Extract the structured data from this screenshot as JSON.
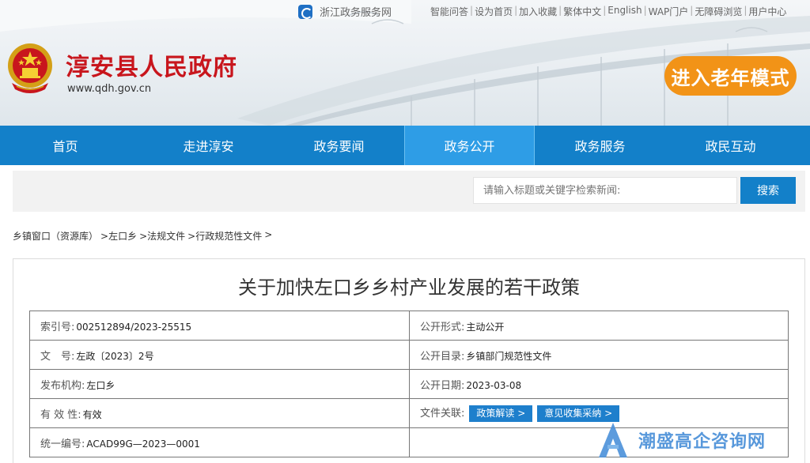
{
  "topbar": {
    "portal_label": "浙江政务服务网",
    "links": [
      "智能问答",
      "设为首页",
      "加入收藏",
      "繁体中文",
      "English",
      "WAP门户",
      "无障碍浏览",
      "用户中心"
    ]
  },
  "header": {
    "site_title": "淳安县人民政府",
    "site_url": "www.qdh.gov.cn",
    "elder_mode_label": "进入老年模式",
    "colors": {
      "title_red": "#c8161d",
      "elder_orange": "#f29317"
    }
  },
  "nav": {
    "items": [
      "首页",
      "走进淳安",
      "政务要闻",
      "政务公开",
      "政务服务",
      "政民互动"
    ],
    "active_index": 3,
    "colors": {
      "bar": "#1380c9",
      "active": "#2e9de6"
    }
  },
  "search": {
    "placeholder": "请输入标题或关键字检索新闻:",
    "button_label": "搜索"
  },
  "breadcrumb": [
    "乡镇窗口（资源库）",
    ">左口乡",
    ">法规文件",
    ">行政规范性文件",
    ">"
  ],
  "document": {
    "title": "关于加快左口乡乡村产业发展的若干政策",
    "meta": {
      "index_label": "索引号:",
      "index_value": "002512894/2023-25515",
      "form_label": "公开形式:",
      "form_value": "主动公开",
      "docno_label": "文　号:",
      "docno_value": "左政〔2023〕2号",
      "catalog_label": "公开目录:",
      "catalog_value": "乡镇部门规范性文件",
      "issuer_label": "发布机构:",
      "issuer_value": "左口乡",
      "date_label": "公开日期:",
      "date_value": "2023-03-08",
      "validity_label": "有 效 性:",
      "validity_value": "有效",
      "related_label": "文件关联:",
      "related_buttons": [
        "政策解读 >",
        "意见收集采纳 >"
      ],
      "serial_label": "统一编号:",
      "serial_value": "ACAD99G—2023—0001"
    }
  },
  "watermark": {
    "text": "潮盛高企咨询网",
    "logo_letter": "A"
  }
}
